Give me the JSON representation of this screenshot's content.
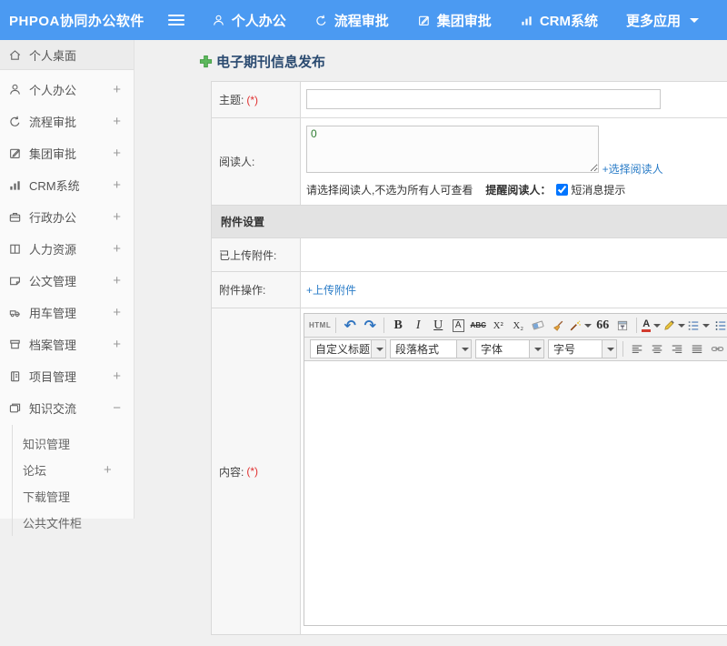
{
  "app_title": "PHPOA协同办公软件",
  "header": {
    "nav": [
      {
        "label": "个人办公"
      },
      {
        "label": "流程审批"
      },
      {
        "label": "集团审批"
      },
      {
        "label": "CRM系统"
      },
      {
        "label": "更多应用"
      }
    ]
  },
  "sidebar": {
    "items": [
      {
        "label": "个人桌面",
        "expand": ""
      },
      {
        "label": "个人办公",
        "expand": "+"
      },
      {
        "label": "流程审批",
        "expand": "+"
      },
      {
        "label": "集团审批",
        "expand": "+"
      },
      {
        "label": "CRM系统",
        "expand": "+"
      },
      {
        "label": "行政办公",
        "expand": "+"
      },
      {
        "label": "人力资源",
        "expand": "+"
      },
      {
        "label": "公文管理",
        "expand": "+"
      },
      {
        "label": "用车管理",
        "expand": "+"
      },
      {
        "label": "档案管理",
        "expand": "+"
      },
      {
        "label": "项目管理",
        "expand": "+"
      },
      {
        "label": "知识交流",
        "expand": "−"
      }
    ],
    "subitems": [
      {
        "label": "知识管理",
        "expand": ""
      },
      {
        "label": "论坛",
        "expand": "+"
      },
      {
        "label": "下载管理",
        "expand": ""
      },
      {
        "label": "公共文件柜",
        "expand": ""
      }
    ]
  },
  "page": {
    "title": "电子期刊信息发布"
  },
  "form": {
    "subject": {
      "label": "主题:",
      "required": "(*)",
      "value": ""
    },
    "readers": {
      "label": "阅读人:",
      "value": "0",
      "select_link": "+选择阅读人",
      "hint": "请选择阅读人,不选为所有人可查看",
      "remind_label": "提醒阅读人：",
      "sms_label": "短消息提示",
      "sms_checked": true
    },
    "attachments": {
      "section_title": "附件设置",
      "uploaded_label": "已上传附件:",
      "uploaded_value": "",
      "action_label": "附件操作:",
      "upload_link": "+上传附件"
    },
    "content": {
      "label": "内容:",
      "required": "(*)"
    }
  },
  "editor": {
    "buttons": {
      "html": "HTML",
      "undo": "↶",
      "redo": "↷",
      "bold": "B",
      "italic": "I",
      "underline": "U",
      "font_box": "A",
      "strike": "ABC",
      "sup": "X²",
      "sub": "X₂",
      "quote": "66",
      "font_color": "A"
    },
    "dropdowns": [
      {
        "label": "自定义标题"
      },
      {
        "label": "段落格式"
      },
      {
        "label": "字体"
      },
      {
        "label": "字号"
      }
    ]
  },
  "colors": {
    "header_bg": "#4b9af2",
    "link_blue": "#2a7cc7",
    "title_text": "#2a4a70",
    "required_red": "#e03030",
    "plus_green": "#5cb85c",
    "readers_value_green": "#2f7d32",
    "section_bg": "#e3e3e3"
  }
}
